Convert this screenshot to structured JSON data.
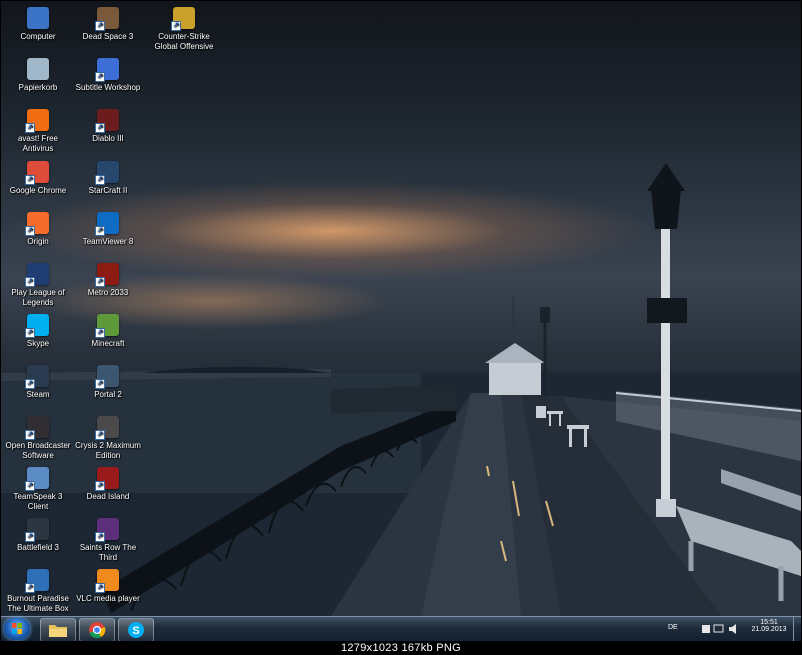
{
  "desktop": {
    "icons": [
      {
        "label": "Computer",
        "icon": "computer-icon",
        "color": "#3b74c7"
      },
      {
        "label": "Papierkorb",
        "icon": "recycle-bin-icon",
        "color": "#9fb7c9"
      },
      {
        "label": "avast! Free Antivirus",
        "icon": "avast-icon",
        "color": "#f06d12"
      },
      {
        "label": "Google Chrome",
        "icon": "chrome-icon",
        "color": "#dd4b39"
      },
      {
        "label": "Origin",
        "icon": "origin-icon",
        "color": "#f56c2d"
      },
      {
        "label": "Play League of Legends",
        "icon": "league-of-legends-icon",
        "color": "#1f3d73"
      },
      {
        "label": "Skype",
        "icon": "skype-icon",
        "color": "#00aff0"
      },
      {
        "label": "Steam",
        "icon": "steam-icon",
        "color": "#2b3b4f"
      },
      {
        "label": "Open Broadcaster Software",
        "icon": "obs-icon",
        "color": "#302e31"
      },
      {
        "label": "TeamSpeak 3 Client",
        "icon": "teamspeak-icon",
        "color": "#5b8cc4"
      },
      {
        "label": "Battlefield 3",
        "icon": "battlefield-icon",
        "color": "#2c3640"
      },
      {
        "label": "Burnout Paradise The Ultimate Box",
        "icon": "burnout-icon",
        "color": "#2e6fb8"
      },
      {
        "label": "Dead Space 3",
        "icon": "dead-space-icon",
        "color": "#7a5a3b"
      },
      {
        "label": "Subtitle Workshop",
        "icon": "subtitle-workshop-icon",
        "color": "#3d6ed6"
      },
      {
        "label": "Diablo III",
        "icon": "diablo-icon",
        "color": "#6b1d1d"
      },
      {
        "label": "StarCraft II",
        "icon": "starcraft-icon",
        "color": "#26466b"
      },
      {
        "label": "TeamViewer 8",
        "icon": "teamviewer-icon",
        "color": "#0e6cc4"
      },
      {
        "label": "Metro 2033",
        "icon": "metro-icon",
        "color": "#8c1b14"
      },
      {
        "label": "Minecraft",
        "icon": "minecraft-icon",
        "color": "#5e9a3a"
      },
      {
        "label": "Portal 2",
        "icon": "portal-icon",
        "color": "#3d5670"
      },
      {
        "label": "Crysis 2 Maximum Edition",
        "icon": "crysis-icon",
        "color": "#4a4a4a"
      },
      {
        "label": "Dead Island",
        "icon": "dead-island-icon",
        "color": "#9a1b1b"
      },
      {
        "label": "Saints Row The Third",
        "icon": "saints-row-icon",
        "color": "#5b2f7a"
      },
      {
        "label": "VLC media player",
        "icon": "vlc-icon",
        "color": "#f08a1c"
      },
      {
        "label": "Counter-Strike Global Offensive",
        "icon": "csgo-icon",
        "color": "#c9a02b"
      }
    ]
  },
  "taskbar": {
    "pinned": [
      {
        "name": "explorer",
        "icon": "folder-icon"
      },
      {
        "name": "chrome",
        "icon": "chrome-icon"
      },
      {
        "name": "skype",
        "icon": "skype-icon"
      }
    ],
    "language": "DE",
    "time": "15:51",
    "date": "21.09.2013"
  },
  "caption": "1279x1023  167kb  PNG"
}
